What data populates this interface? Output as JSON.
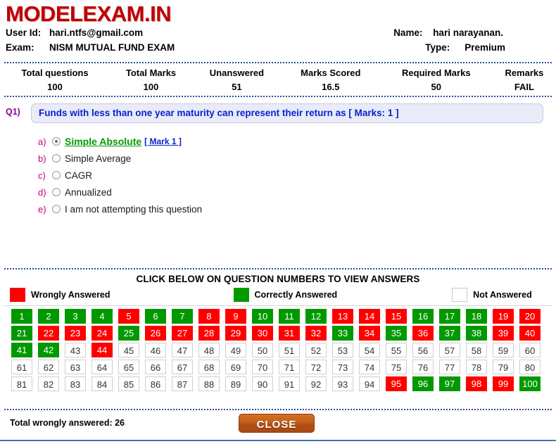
{
  "header": {
    "logo": "MODELEXAM.IN",
    "user_id_label": "User Id:",
    "user_id_value": "hari.ntfs@gmail.com",
    "name_label": "Name:",
    "name_value": "hari narayanan.",
    "exam_label": "Exam:",
    "exam_value": "NISM MUTUAL FUND EXAM",
    "type_label": "Type:",
    "type_value": "Premium"
  },
  "summary": {
    "headers": [
      "Total questions",
      "Total Marks",
      "Unanswered",
      "Marks Scored",
      "Required Marks",
      "Remarks"
    ],
    "values": [
      "100",
      "100",
      "51",
      "16.5",
      "50",
      "FAIL"
    ]
  },
  "question": {
    "number": "Q1)",
    "text": "Funds with less than one year maturity can represent their return as [ Marks: 1 ]",
    "options": [
      {
        "letter": "a)",
        "text": "Simple Absolute",
        "selected": true,
        "correct": true,
        "mark": "[ Mark 1 ]"
      },
      {
        "letter": "b)",
        "text": "Simple Average",
        "selected": false,
        "correct": false,
        "mark": ""
      },
      {
        "letter": "c)",
        "text": "CAGR",
        "selected": false,
        "correct": false,
        "mark": ""
      },
      {
        "letter": "d)",
        "text": "Annualized",
        "selected": false,
        "correct": false,
        "mark": ""
      },
      {
        "letter": "e)",
        "text": "I am not attempting this question",
        "selected": false,
        "correct": false,
        "mark": ""
      }
    ]
  },
  "grid_section": {
    "title": "CLICK BELOW ON QUESTION NUMBERS TO VIEW ANSWERS",
    "legend": [
      {
        "state": "red",
        "label": "Wrongly Answered"
      },
      {
        "state": "green",
        "label": "Correctly Answered"
      },
      {
        "state": "white",
        "label": "Not Answered"
      }
    ],
    "cells": [
      {
        "n": "1",
        "s": "green"
      },
      {
        "n": "2",
        "s": "green"
      },
      {
        "n": "3",
        "s": "green"
      },
      {
        "n": "4",
        "s": "green"
      },
      {
        "n": "5",
        "s": "red"
      },
      {
        "n": "6",
        "s": "green"
      },
      {
        "n": "7",
        "s": "green"
      },
      {
        "n": "8",
        "s": "red"
      },
      {
        "n": "9",
        "s": "red"
      },
      {
        "n": "10",
        "s": "green"
      },
      {
        "n": "11",
        "s": "green"
      },
      {
        "n": "12",
        "s": "green"
      },
      {
        "n": "13",
        "s": "red"
      },
      {
        "n": "14",
        "s": "red"
      },
      {
        "n": "15",
        "s": "red"
      },
      {
        "n": "16",
        "s": "green"
      },
      {
        "n": "17",
        "s": "green"
      },
      {
        "n": "18",
        "s": "green"
      },
      {
        "n": "19",
        "s": "red"
      },
      {
        "n": "20",
        "s": "red"
      },
      {
        "n": "21",
        "s": "green"
      },
      {
        "n": "22",
        "s": "red"
      },
      {
        "n": "23",
        "s": "red"
      },
      {
        "n": "24",
        "s": "red"
      },
      {
        "n": "25",
        "s": "green"
      },
      {
        "n": "26",
        "s": "red"
      },
      {
        "n": "27",
        "s": "red"
      },
      {
        "n": "28",
        "s": "red"
      },
      {
        "n": "29",
        "s": "red"
      },
      {
        "n": "30",
        "s": "red"
      },
      {
        "n": "31",
        "s": "red"
      },
      {
        "n": "32",
        "s": "red"
      },
      {
        "n": "33",
        "s": "green"
      },
      {
        "n": "34",
        "s": "red"
      },
      {
        "n": "35",
        "s": "green"
      },
      {
        "n": "36",
        "s": "red"
      },
      {
        "n": "37",
        "s": "green"
      },
      {
        "n": "38",
        "s": "green"
      },
      {
        "n": "39",
        "s": "red"
      },
      {
        "n": "40",
        "s": "red"
      },
      {
        "n": "41",
        "s": "green"
      },
      {
        "n": "42",
        "s": "green"
      },
      {
        "n": "43",
        "s": "white"
      },
      {
        "n": "44",
        "s": "red"
      },
      {
        "n": "45",
        "s": "white"
      },
      {
        "n": "46",
        "s": "white"
      },
      {
        "n": "47",
        "s": "white"
      },
      {
        "n": "48",
        "s": "white"
      },
      {
        "n": "49",
        "s": "white"
      },
      {
        "n": "50",
        "s": "white"
      },
      {
        "n": "51",
        "s": "white"
      },
      {
        "n": "52",
        "s": "white"
      },
      {
        "n": "53",
        "s": "white"
      },
      {
        "n": "54",
        "s": "white"
      },
      {
        "n": "55",
        "s": "white"
      },
      {
        "n": "56",
        "s": "white"
      },
      {
        "n": "57",
        "s": "white"
      },
      {
        "n": "58",
        "s": "white"
      },
      {
        "n": "59",
        "s": "white"
      },
      {
        "n": "60",
        "s": "white"
      },
      {
        "n": "61",
        "s": "white"
      },
      {
        "n": "62",
        "s": "white"
      },
      {
        "n": "63",
        "s": "white"
      },
      {
        "n": "64",
        "s": "white"
      },
      {
        "n": "65",
        "s": "white"
      },
      {
        "n": "66",
        "s": "white"
      },
      {
        "n": "67",
        "s": "white"
      },
      {
        "n": "68",
        "s": "white"
      },
      {
        "n": "69",
        "s": "white"
      },
      {
        "n": "70",
        "s": "white"
      },
      {
        "n": "71",
        "s": "white"
      },
      {
        "n": "72",
        "s": "white"
      },
      {
        "n": "73",
        "s": "white"
      },
      {
        "n": "74",
        "s": "white"
      },
      {
        "n": "75",
        "s": "white"
      },
      {
        "n": "76",
        "s": "white"
      },
      {
        "n": "77",
        "s": "white"
      },
      {
        "n": "78",
        "s": "white"
      },
      {
        "n": "79",
        "s": "white"
      },
      {
        "n": "80",
        "s": "white"
      },
      {
        "n": "81",
        "s": "white"
      },
      {
        "n": "82",
        "s": "white"
      },
      {
        "n": "83",
        "s": "white"
      },
      {
        "n": "84",
        "s": "white"
      },
      {
        "n": "85",
        "s": "white"
      },
      {
        "n": "86",
        "s": "white"
      },
      {
        "n": "87",
        "s": "white"
      },
      {
        "n": "88",
        "s": "white"
      },
      {
        "n": "89",
        "s": "white"
      },
      {
        "n": "90",
        "s": "white"
      },
      {
        "n": "91",
        "s": "white"
      },
      {
        "n": "92",
        "s": "white"
      },
      {
        "n": "93",
        "s": "white"
      },
      {
        "n": "94",
        "s": "white"
      },
      {
        "n": "95",
        "s": "red"
      },
      {
        "n": "96",
        "s": "green"
      },
      {
        "n": "97",
        "s": "green"
      },
      {
        "n": "98",
        "s": "red"
      },
      {
        "n": "99",
        "s": "red"
      },
      {
        "n": "100",
        "s": "green"
      }
    ]
  },
  "footer": {
    "total_wrong": "Total wrongly answered: 26",
    "close_label": "CLOSE"
  },
  "colors": {
    "wrong": "#ff0000",
    "correct": "#009900",
    "not_answered": "#ffffff",
    "brand": "#c00000",
    "question_text": "#0a1fd0",
    "close_button": "#c4601c"
  }
}
